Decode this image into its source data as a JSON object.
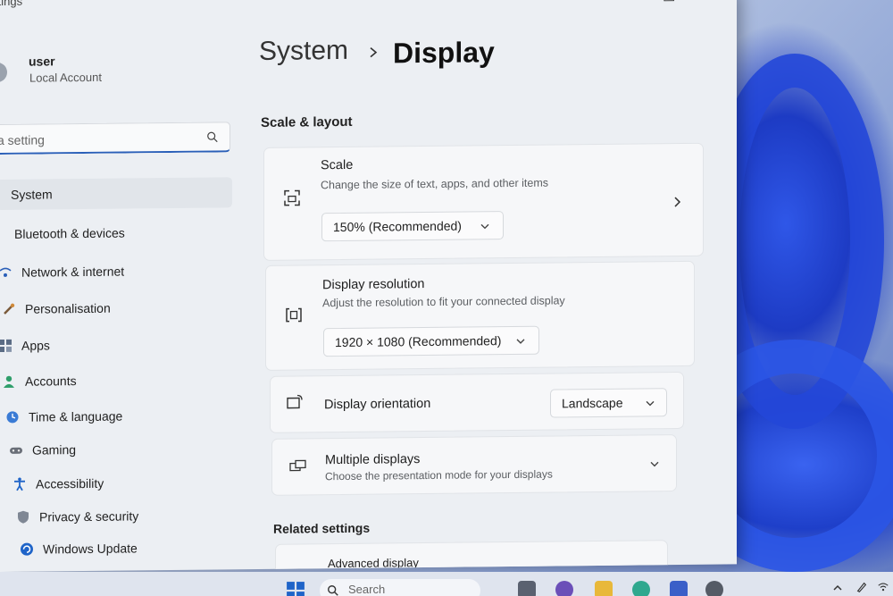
{
  "window": {
    "title": "ttings"
  },
  "user": {
    "name": "user",
    "account_type": "Local Account"
  },
  "search": {
    "placeholder": "a setting"
  },
  "sidebar": {
    "items": [
      {
        "label": "System"
      },
      {
        "label": "Bluetooth & devices"
      },
      {
        "label": "Network & internet"
      },
      {
        "label": "Personalisation"
      },
      {
        "label": "Apps"
      },
      {
        "label": "Accounts"
      },
      {
        "label": "Time & language"
      },
      {
        "label": "Gaming"
      },
      {
        "label": "Accessibility"
      },
      {
        "label": "Privacy & security"
      },
      {
        "label": "Windows Update"
      }
    ]
  },
  "breadcrumb": {
    "parent": "System",
    "current": "Display"
  },
  "scale_layout": {
    "title": "Scale & layout",
    "scale": {
      "title": "Scale",
      "subtitle": "Change the size of text, apps, and other items",
      "value": "150% (Recommended)"
    },
    "resolution": {
      "title": "Display resolution",
      "subtitle": "Adjust the resolution to fit your connected display",
      "value": "1920 × 1080 (Recommended)"
    },
    "orientation": {
      "title": "Display orientation",
      "value": "Landscape"
    },
    "multiple": {
      "title": "Multiple displays",
      "subtitle": "Choose the presentation mode for your displays"
    }
  },
  "related": {
    "title": "Related settings",
    "advanced": "Advanced display"
  },
  "taskbar": {
    "search_placeholder": "Search"
  },
  "colors": {
    "accent": "#2a5fb8",
    "window_bg": "#eceff3",
    "card_bg": "#f6f7f9"
  }
}
